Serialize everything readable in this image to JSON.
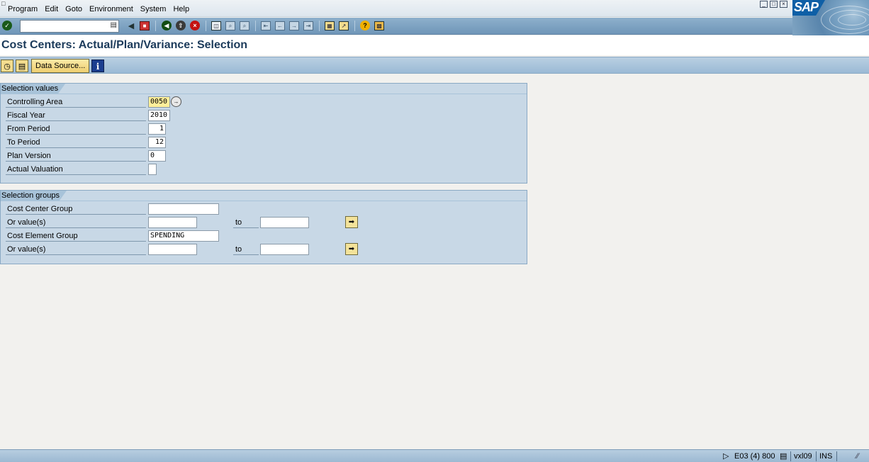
{
  "menu": {
    "items": [
      "Program",
      "Edit",
      "Goto",
      "Environment",
      "System",
      "Help"
    ]
  },
  "window_controls": [
    "minimize",
    "maximize",
    "close"
  ],
  "brand": {
    "logo": "SAP",
    "color": "#0e5fa6"
  },
  "std_toolbar": {
    "command_field": "",
    "icons": [
      "enter-icon",
      "save-icon",
      "back-icon",
      "exit-icon",
      "cancel-icon",
      "print-icon",
      "find-icon",
      "find-next-icon",
      "first-page-icon",
      "previous-page-icon",
      "next-page-icon",
      "last-page-icon",
      "new-session-icon",
      "shortcut-icon",
      "help-icon",
      "customize-layout-icon"
    ]
  },
  "title": "Cost Centers: Actual/Plan/Variance: Selection",
  "app_toolbar": {
    "data_source_label": "Data Source...",
    "icons": [
      "execute-icon",
      "variant-icon",
      "info-icon"
    ]
  },
  "selection_values": {
    "title": "Selection values",
    "rows": [
      {
        "label": "Controlling Area",
        "value": "0050"
      },
      {
        "label": "Fiscal Year",
        "value": "2010"
      },
      {
        "label": "From Period",
        "value": "1"
      },
      {
        "label": "To Period",
        "value": "12"
      },
      {
        "label": "Plan Version",
        "value": "0"
      },
      {
        "label": "Actual Valuation",
        "value": ""
      }
    ]
  },
  "selection_groups": {
    "title": "Selection groups",
    "to_label": "to",
    "rows": [
      {
        "label": "Cost Center Group",
        "value": ""
      },
      {
        "label": "Or value(s)",
        "from": "",
        "to": ""
      },
      {
        "label": "Cost Element Group",
        "value": "SPENDING"
      },
      {
        "label": "Or value(s)",
        "from": "",
        "to": ""
      }
    ]
  },
  "status_bar": {
    "system": "E03 (4) 800",
    "server": "vxl09",
    "mode": "INS"
  },
  "colors": {
    "toolbar": "#7fa3c2",
    "groupbox": "#c8d8e6",
    "required_field": "#ffef9a",
    "title": "#1b3a5a"
  }
}
